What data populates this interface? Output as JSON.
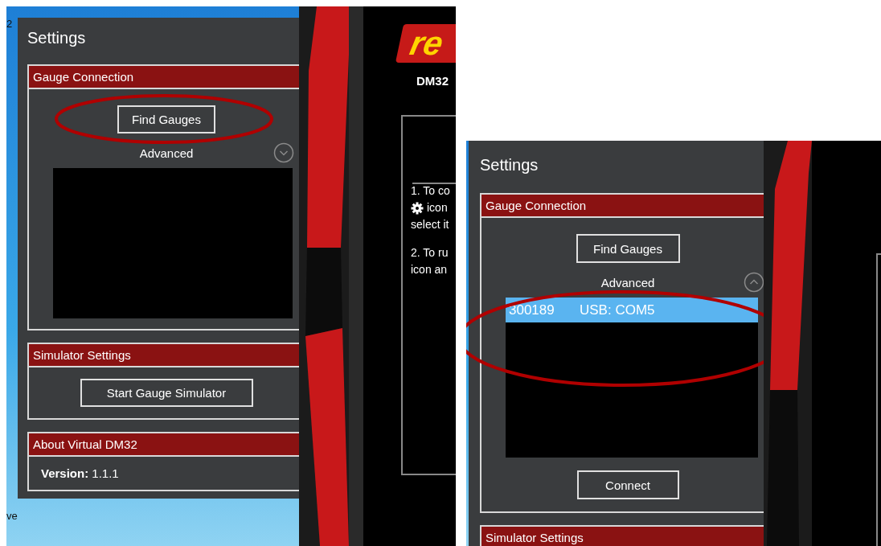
{
  "left_screenshot": {
    "desktop_labels": [
      "2",
      "ve"
    ],
    "settings": {
      "title": "Settings",
      "sections": [
        {
          "kind": "connection",
          "title": "Gauge Connection",
          "button": "Find Gauges",
          "advanced_label": "Advanced"
        },
        {
          "kind": "simulator",
          "title": "Simulator Settings",
          "button": "Start Gauge Simulator"
        },
        {
          "kind": "about",
          "title": "About Virtual DM32",
          "version_label": "Version:",
          "version": "1.1.1"
        }
      ]
    },
    "app": {
      "logo_text": "re",
      "model": "DM32",
      "instruction_lines": [
        {
          "kind": "text",
          "text": "1. To co"
        },
        {
          "kind": "gear_text",
          "text": "icon"
        },
        {
          "kind": "text",
          "text": "select it"
        },
        {
          "kind": "paragraph",
          "text": "2. To ru"
        },
        {
          "kind": "text",
          "text": "icon an"
        }
      ]
    }
  },
  "right_screenshot": {
    "settings": {
      "title": "Settings",
      "sections": [
        {
          "kind": "connection",
          "title": "Gauge Connection",
          "button": "Find Gauges",
          "advanced_label": "Advanced",
          "devices": [
            {
              "serial": "300189",
              "port": "USB: COM5",
              "selected": true
            }
          ],
          "connect_button": "Connect"
        },
        {
          "kind": "simulator",
          "title": "Simulator Settings"
        }
      ]
    }
  }
}
